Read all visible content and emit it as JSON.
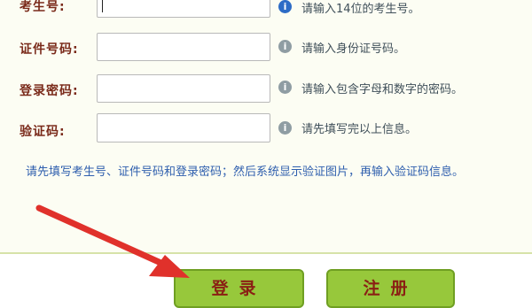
{
  "form": {
    "rows": [
      {
        "label": "考生号:",
        "hint": "请输入14位的考生号。"
      },
      {
        "label": "证件号码:",
        "hint": "请输入身份证号码。"
      },
      {
        "label": "登录密码:",
        "hint": "请输入包含字母和数字的密码。"
      },
      {
        "label": "验证码:",
        "hint": "请先填写完以上信息。"
      }
    ],
    "note": "请先填写考生号、证件号码和登录密码；然后系统显示验证图片，再输入验证码信息。",
    "hint_icon": "i",
    "buttons": {
      "login": "登录",
      "register": "注册"
    }
  },
  "colors": {
    "label": "#7a2a1a",
    "note": "#2f5fae",
    "button_bg": "#97c83b",
    "arrow": "#e0312b"
  },
  "icons": {
    "hint": "info-icon",
    "pointer": "red-arrow-annotation"
  }
}
